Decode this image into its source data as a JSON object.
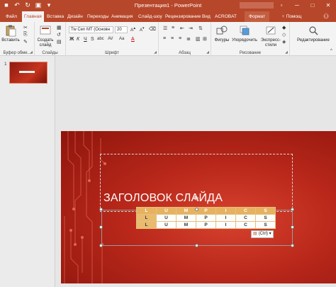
{
  "window": {
    "title": "Презентация1 - PowerPoint",
    "controls": [
      "restore",
      "minimize",
      "maximize",
      "close"
    ]
  },
  "qat": {
    "icons": [
      "save-icon",
      "undo-icon",
      "redo-icon",
      "present-icon",
      "customize-icon"
    ]
  },
  "tabs": [
    {
      "label": "Файл"
    },
    {
      "label": "Главная"
    },
    {
      "label": "Вставка"
    },
    {
      "label": "Дизайн"
    },
    {
      "label": "Переходы"
    },
    {
      "label": "Анимация"
    },
    {
      "label": "Слайд-шоу"
    },
    {
      "label": "Рецензирование"
    },
    {
      "label": "Вид"
    },
    {
      "label": "ACROBAT"
    },
    {
      "label": "Формат"
    }
  ],
  "help": {
    "label": "Помощ"
  },
  "ribbon": {
    "clipboard": {
      "paste_label": "Вставить",
      "group_label": "Буфер обме..."
    },
    "slides": {
      "create_label1": "Создать",
      "create_label2": "слайд",
      "group_label": "Слайды"
    },
    "font": {
      "font_name": "Tw Cen MT (Основн",
      "font_size": "20",
      "group_label": "Шрифт",
      "bold": "Ж",
      "italic": "К",
      "underline": "Ч",
      "strike": "S",
      "shadow": "abc",
      "spacing": "AV",
      "case": "Aa",
      "color": "A"
    },
    "paragraph": {
      "group_label": "Абзац"
    },
    "drawing": {
      "shapes_label": "Фигуры",
      "arrange_label": "Упорядочить",
      "styles_label1": "Экспресс-",
      "styles_label2": "стили",
      "group_label": "Рисование"
    },
    "editing": {
      "label": "Редактирование"
    }
  },
  "thumbnails": [
    {
      "number": "1"
    }
  ],
  "slide": {
    "title": "ЗАГОЛОВОК СЛАЙДА",
    "table": [
      [
        "L",
        "U",
        "M",
        "P",
        "I",
        "C",
        "S"
      ],
      [
        "L",
        "U",
        "M",
        "P",
        "I",
        "C",
        "S"
      ],
      [
        "L",
        "U",
        "M",
        "P",
        "I",
        "C",
        "S"
      ]
    ]
  },
  "paste_options": {
    "label": "(Ctrl)"
  },
  "colors": {
    "accent": "#b7472a",
    "table_header": "#e6b261",
    "slide_red": "#b8271a"
  }
}
